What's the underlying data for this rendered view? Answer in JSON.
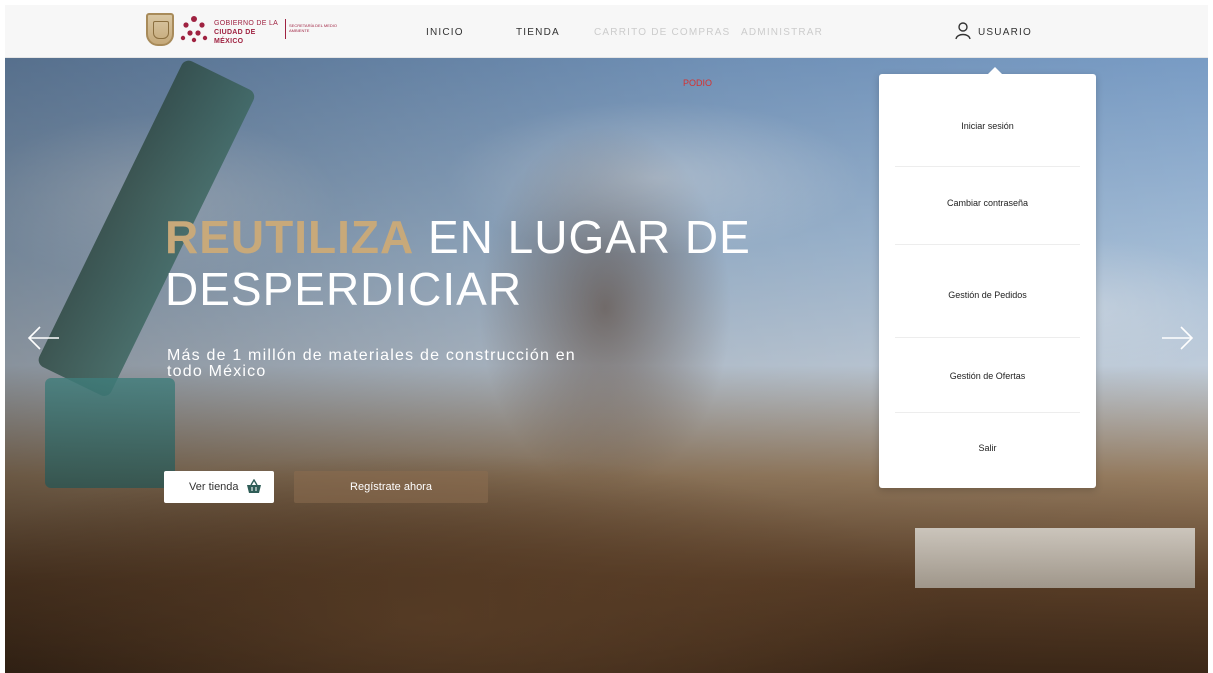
{
  "header": {
    "logo": {
      "line1": "GOBIERNO DE LA",
      "line2": "CIUDAD DE MÉXICO",
      "sub": "SECRETARÍA DEL MEDIO AMBIENTE"
    },
    "nav": [
      {
        "label": "INICIO",
        "enabled": true
      },
      {
        "label": "TIENDA",
        "enabled": true
      },
      {
        "label": "CARRITO DE COMPRAS",
        "enabled": false
      },
      {
        "label": "ADMINISTRAR",
        "enabled": false
      }
    ],
    "user_label": "USUARIO",
    "user_icon": "user-icon"
  },
  "hero": {
    "tag": "PODIO",
    "headline_accent": "REUTILIZA",
    "headline_rest": " EN LUGAR DE DESPERDICIAR",
    "subline": "Más de 1 millón de materiales de construcción en todo México",
    "primary_button": "Ver tienda",
    "primary_button_icon": "basket-icon",
    "secondary_button": "Regístrate ahora",
    "prev_icon": "arrow-left-icon",
    "next_icon": "arrow-right-icon"
  },
  "user_menu": {
    "items": [
      "Iniciar sesión",
      "Cambiar contraseña",
      "Gestión de Pedidos",
      "Gestión de Ofertas",
      "Salir"
    ]
  },
  "colors": {
    "brand": "#9f2241",
    "accent": "#c8a97a",
    "nav_text": "#333333",
    "nav_disabled": "#cccccc",
    "tag_red": "#d63030"
  }
}
